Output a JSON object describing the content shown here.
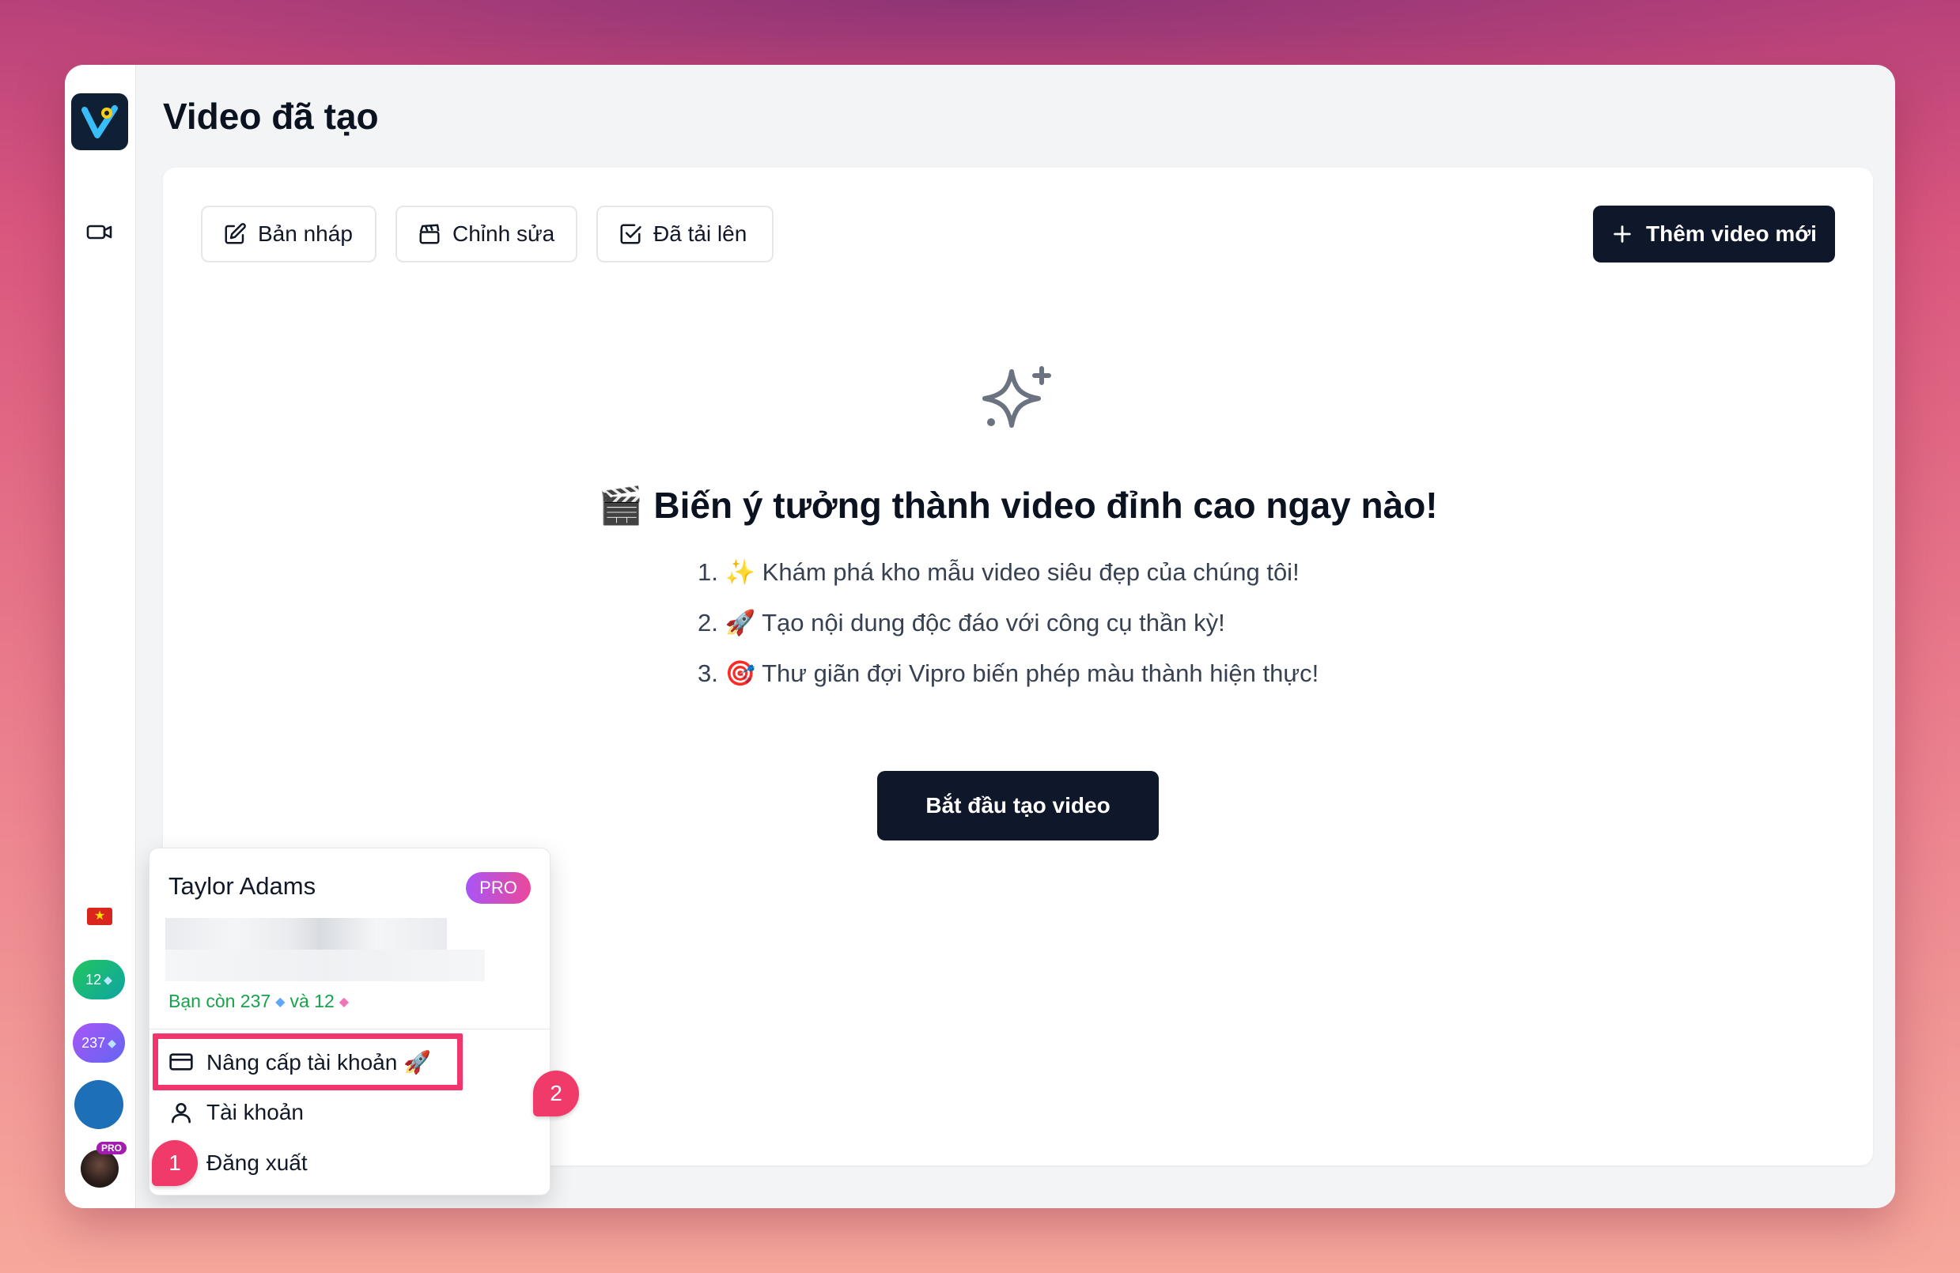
{
  "page": {
    "title": "Video đã tạo"
  },
  "sidebar": {
    "credits": [
      {
        "value": "12",
        "icon": "gem-icon",
        "color": "#22c55e"
      },
      {
        "value": "237",
        "icon": "gem-icon",
        "color": "#8b5cf6"
      }
    ],
    "avatar_badge": "PRO"
  },
  "toolbar": {
    "tabs": [
      {
        "label": "Bản nháp",
        "icon": "edit-icon"
      },
      {
        "label": "Chỉnh sửa",
        "icon": "clapperboard-icon"
      },
      {
        "label": "Đã tải lên",
        "icon": "checkbox-icon"
      }
    ],
    "add_label": "Thêm video mới"
  },
  "empty_state": {
    "icon": "sparkles-icon",
    "title": "🎬 Biến ý tưởng thành video đỉnh cao ngay nào!",
    "steps": [
      "1. ✨ Khám phá kho mẫu video siêu đẹp của chúng tôi!",
      "2. 🚀 Tạo nội dung độc đáo với công cụ thần kỳ!",
      "3. 🎯 Thư giãn đợi Vipro biến phép màu thành hiện thực!"
    ],
    "cta_label": "Bắt đầu tạo video"
  },
  "user_menu": {
    "name": "Taylor Adams",
    "plan_badge": "PRO",
    "remaining_prefix": "Bạn còn 237",
    "remaining_middle": "và 12",
    "items": [
      {
        "label": "Nâng cấp tài khoản 🚀",
        "icon": "credit-card-icon"
      },
      {
        "label": "Tài khoản",
        "icon": "user-icon"
      },
      {
        "label": "Đăng xuất",
        "icon": "logout-icon"
      }
    ]
  },
  "annotations": {
    "callout_1": "1",
    "callout_2": "2",
    "highlight_color": "#f0366c"
  },
  "colors": {
    "primary_dark": "#0f172a",
    "accent_pink": "#ec4899",
    "success": "#16a34a"
  }
}
